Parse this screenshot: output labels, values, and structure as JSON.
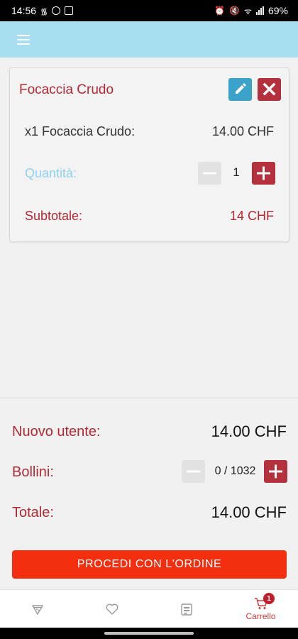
{
  "status_bar": {
    "time": "14:56",
    "battery": "69%"
  },
  "item": {
    "title": "Focaccia Crudo",
    "line_label": "x1 Focaccia Crudo:",
    "line_price": "14.00 CHF",
    "quantity_label": "Quantità:",
    "quantity": "1",
    "subtotal_label": "Subtotale:",
    "subtotal_value": "14 CHF"
  },
  "summary": {
    "new_user_label": "Nuovo utente:",
    "new_user_value": "14.00 CHF",
    "points_label": "Bollini:",
    "points_value": "0 / 1032",
    "total_label": "Totale:",
    "total_value": "14.00 CHF",
    "order_button": "PROCEDI CON L'ORDINE"
  },
  "nav": {
    "items": [
      {
        "icon": "pizza-icon"
      },
      {
        "icon": "heart-icon"
      },
      {
        "icon": "receipt-icon"
      },
      {
        "icon": "cart-icon",
        "label": "Carrello",
        "badge": "1"
      }
    ]
  },
  "colors": {
    "accent": "#b22a35",
    "header": "#a7dff0",
    "edit": "#3ba3c9",
    "order": "#f42f10",
    "quantity_label": "#8fd2ec"
  }
}
